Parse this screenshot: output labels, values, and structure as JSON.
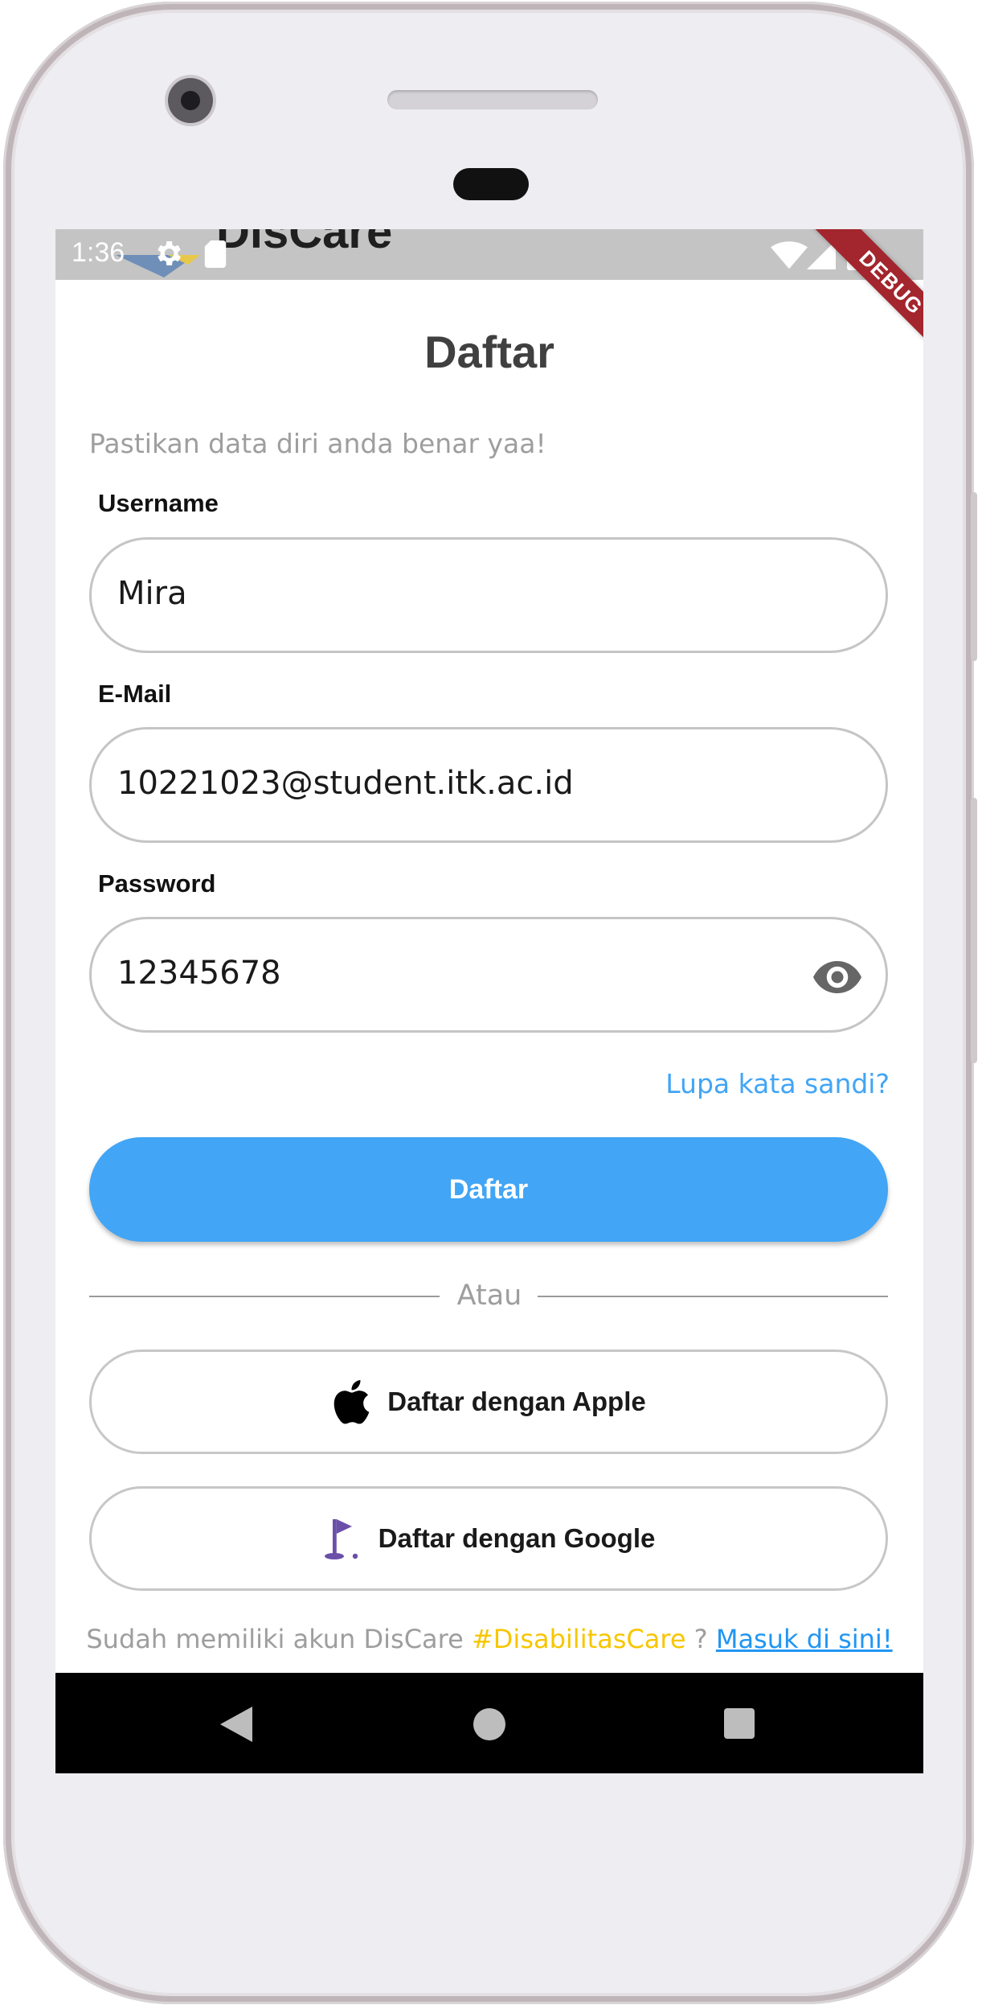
{
  "status_bar": {
    "time": "1:36",
    "app_title": "DisCare"
  },
  "debug_banner": "DEBUG",
  "page": {
    "title": "Daftar",
    "subtitle": "Pastikan data diri anda benar yaa!"
  },
  "form": {
    "username": {
      "label": "Username",
      "value": "Mira"
    },
    "email": {
      "label": "E-Mail",
      "value": "10221023@student.itk.ac.id"
    },
    "password": {
      "label": "Password",
      "value": "12345678",
      "toggle_icon": "eye-icon"
    },
    "forgot_link": "Lupa kata sandi?",
    "submit_label": "Daftar"
  },
  "divider": "Atau",
  "social": {
    "apple": {
      "label": "Daftar dengan Apple",
      "icon": "apple-icon"
    },
    "google": {
      "label": "Daftar dengan Google",
      "icon": "flag-icon"
    }
  },
  "footer": {
    "prefix": "Sudah memiliki akun DisCare ",
    "hashtag": "#DisabilitasCare",
    "middle": " ? ",
    "link": "Masuk di sini!"
  },
  "colors": {
    "primary": "#42a5f5",
    "hashtag": "#f7c600",
    "link": "#2196f3",
    "debug": "#a3252d"
  }
}
